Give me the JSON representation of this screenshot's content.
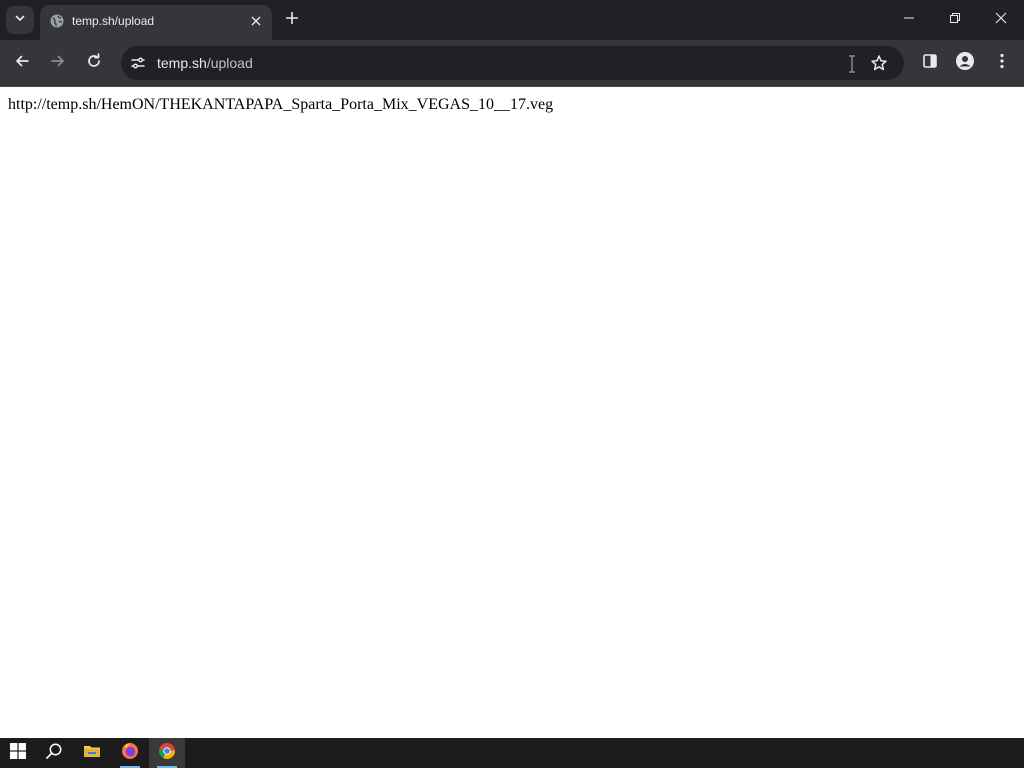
{
  "browser": {
    "tab": {
      "title": "temp.sh/upload"
    },
    "address_bar": {
      "host": "temp.sh",
      "path": "/upload"
    }
  },
  "page": {
    "text": "http://temp.sh/HemON/THEKANTAPAPA_Sparta_Porta_Mix_VEGAS_10__17.veg"
  },
  "icons": {
    "tab_search": "chevron-down-icon",
    "favicon": "globe-icon",
    "tab_close": "close-icon",
    "new_tab": "plus-icon",
    "back": "arrow-left-icon",
    "forward": "arrow-right-icon",
    "reload": "reload-icon",
    "site_info": "tune-icon",
    "bookmark": "star-icon",
    "side_panel": "side-panel-icon",
    "profile": "profile-icon",
    "menu": "kebab-menu-icon"
  },
  "taskbar": {
    "items": [
      "start",
      "search",
      "file-explorer",
      "firefox",
      "chrome"
    ],
    "active": "chrome"
  },
  "colors": {
    "frame": "#202124",
    "toolbar": "#35363a",
    "omnibox": "#202124",
    "taskbar": "#1c1c1c",
    "accent": "#76b9ed"
  }
}
